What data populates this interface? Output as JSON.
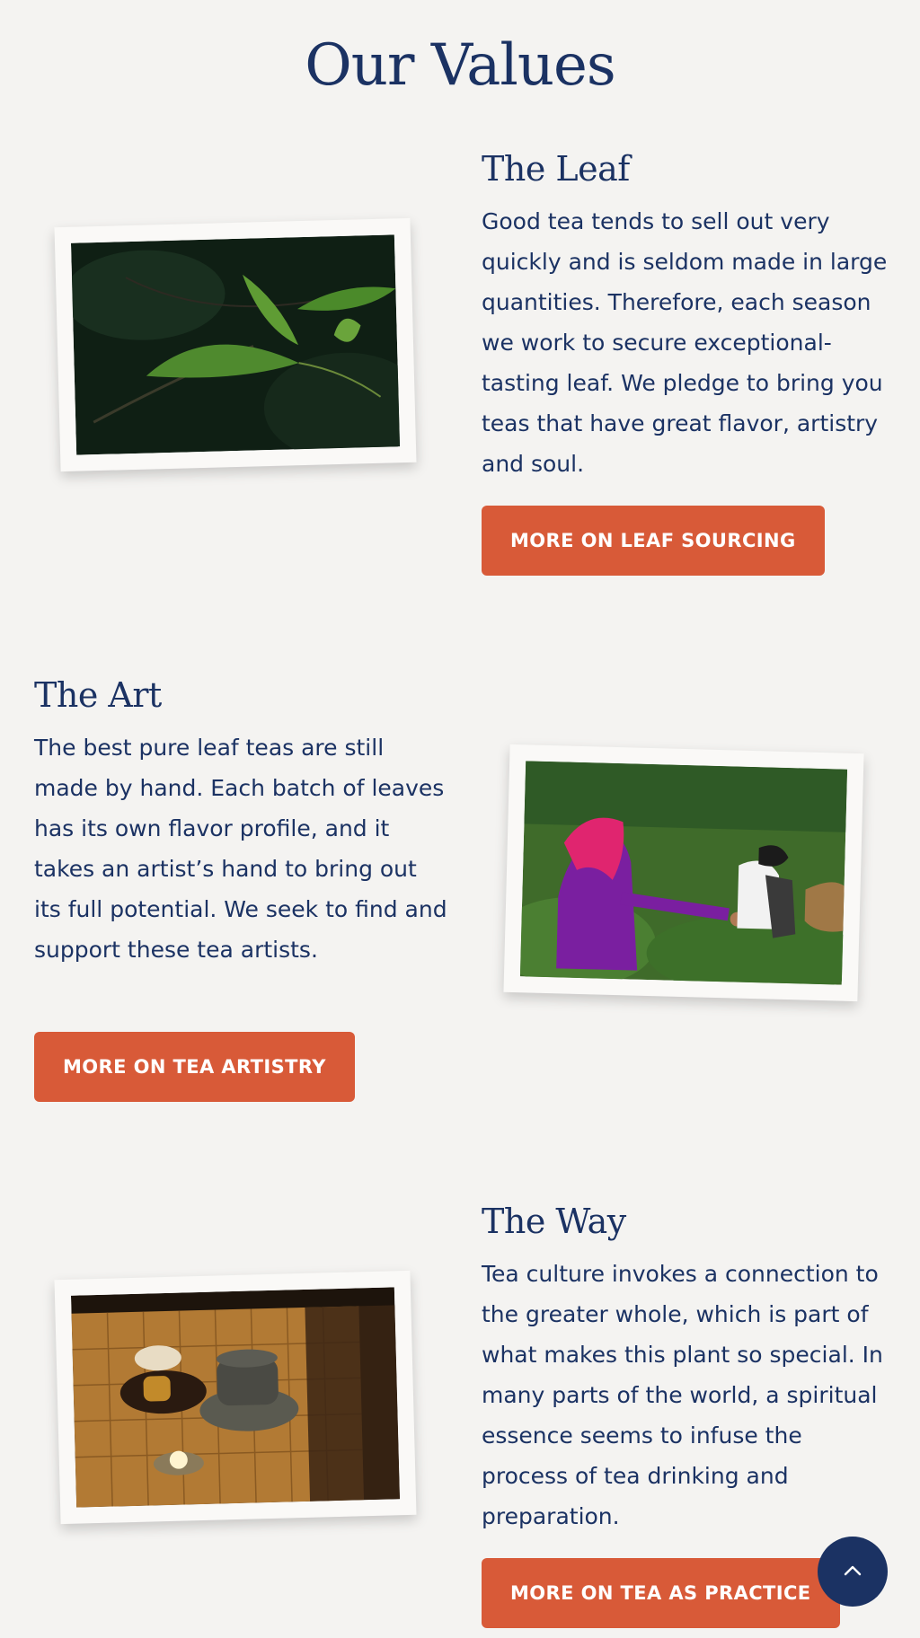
{
  "page": {
    "title": "Our Values"
  },
  "sections": [
    {
      "heading": "The Leaf",
      "text": "Good tea tends to sell out very quickly and is seldom made in large quantities. Therefore, each season we work to secure exceptional-tasting leaf. We pledge to bring you teas that have great flavor, artistry and soul.",
      "button": "MORE ON LEAF SOURCING"
    },
    {
      "heading": "The Art",
      "text": "The best pure leaf teas are still made by hand. Each batch of leaves has its own flavor profile, and it takes an artist’s hand to bring out its full potential. We seek to find and support these tea artists.",
      "button": "MORE ON TEA ARTISTRY"
    },
    {
      "heading": "The Way",
      "text": "Tea culture invokes a connection to the greater whole, which is part of what makes this plant so special. In many parts of the world, a spiritual essence seems to infuse the process of tea drinking and preparation.",
      "button": "MORE ON TEA AS PRACTICE"
    }
  ],
  "images": {
    "leaf": "tea-leaf-photo",
    "art": "tea-pickers-photo",
    "way": "tea-ceremony-photo"
  },
  "icons": {
    "scroll_top": "chevron-up-icon"
  },
  "colors": {
    "background": "#f4f3f1",
    "text": "#1b3263",
    "accent": "#d85a38",
    "scroll_button": "#1b3263"
  }
}
